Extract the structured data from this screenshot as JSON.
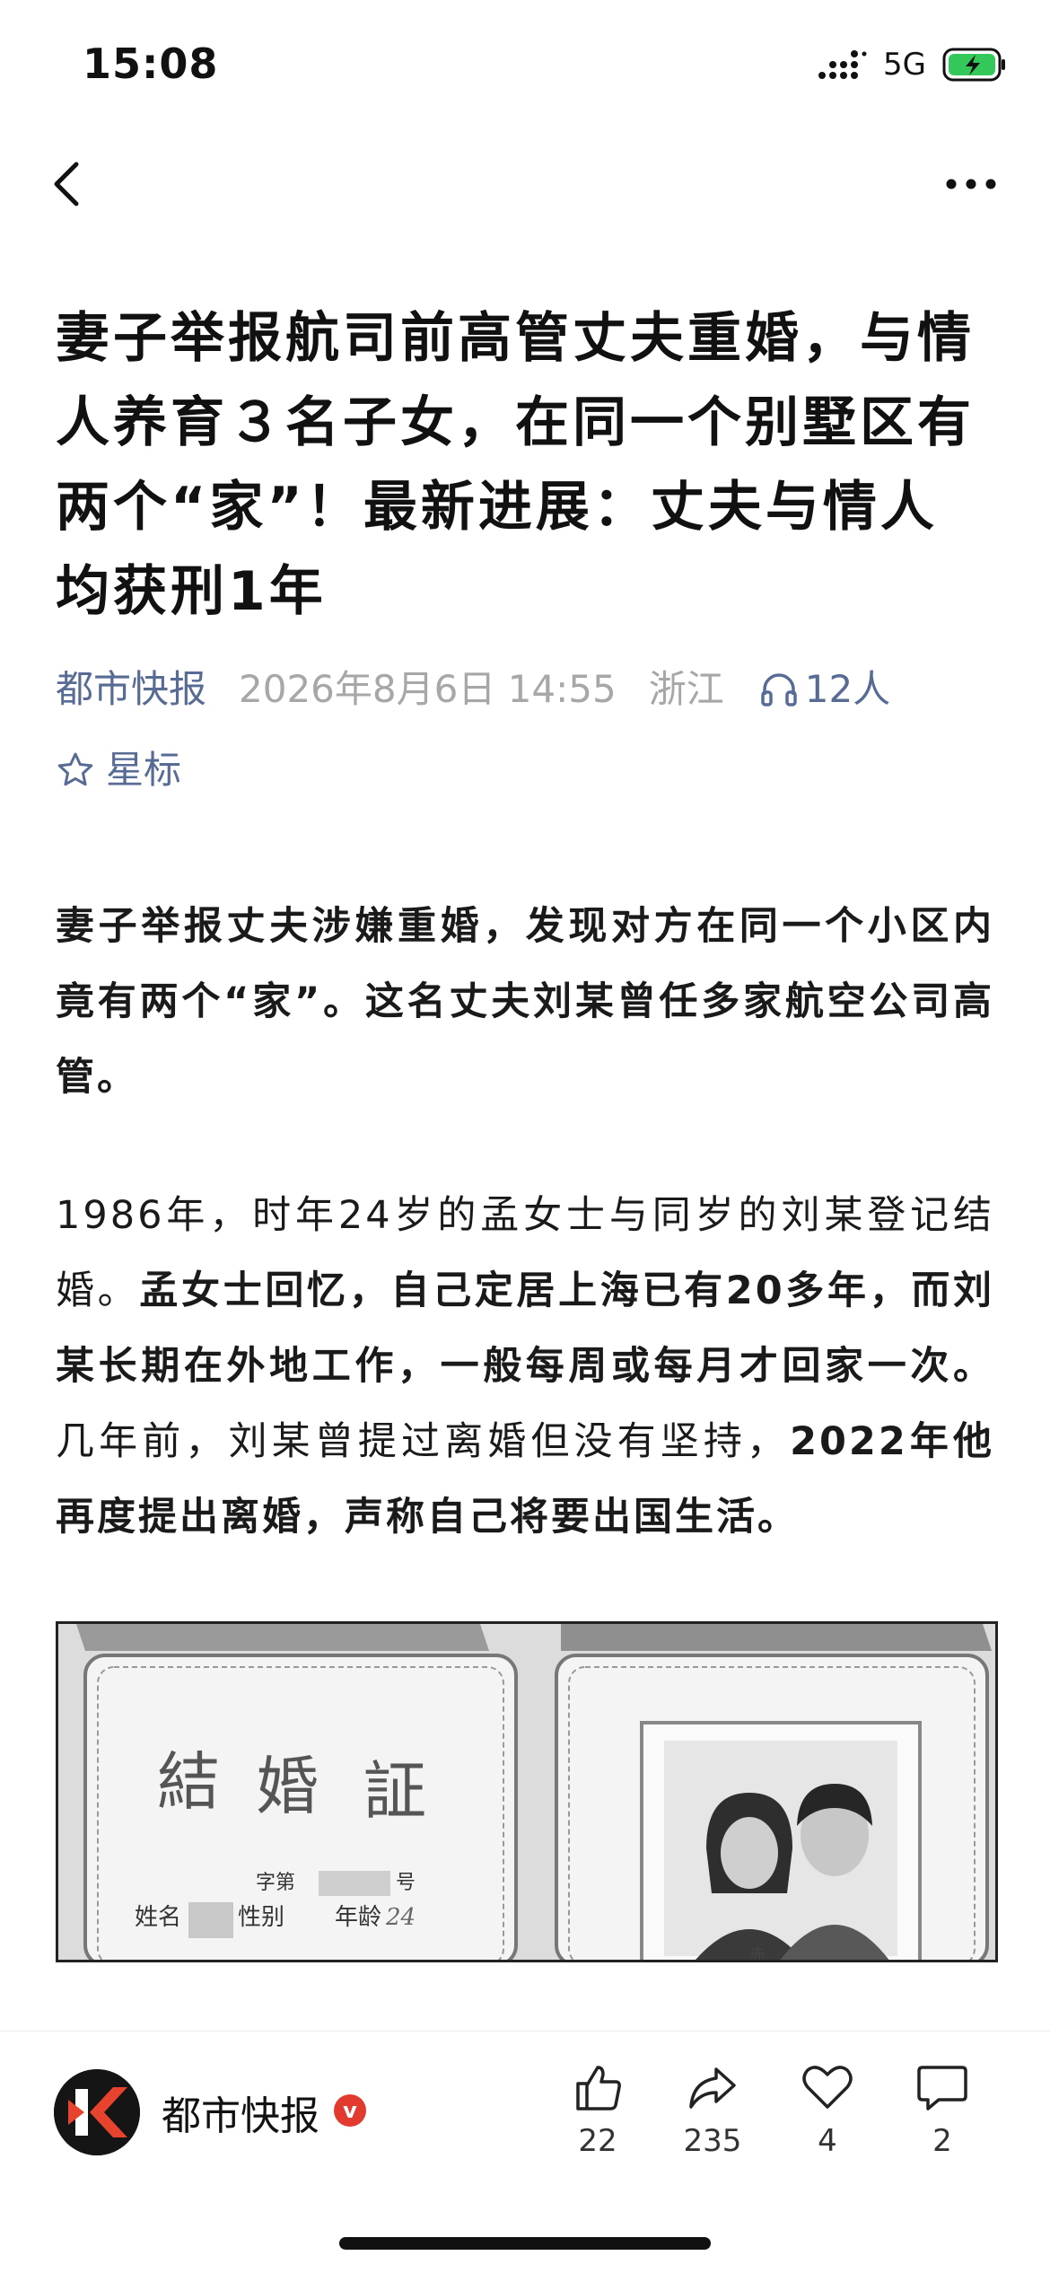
{
  "status_bar": {
    "time": "15:08",
    "network": "5G"
  },
  "article": {
    "title": "妻子举报航司前高管丈夫重婚，与情人养育３名子女，在同一个别墅区有两个“家”！最新进展：丈夫与情人均获刑1年",
    "source": "都市快报",
    "date": "2026年8月6日 14:55",
    "region": "浙江",
    "listeners": "12人",
    "star_label": "星标",
    "para1": "妻子举报丈夫涉嫌重婚，发现对方在同一个小区内竟有两个“家”。这名丈夫刘某曾任多家航空公司高管。",
    "para2_a": "1986年，时年24岁的孟女士与同岁的刘某登记结婚。",
    "para2_b": "孟女士回忆，自己定居上海已有20多年，而刘某长期在外地工作，一般每周或每月才回家一次。",
    "para2_c": "几年前，刘某曾提过离婚但没有坚持，",
    "para2_d": "2022年他再度提出离婚，声称自己将要出国生活。",
    "photo": {
      "title_chars": [
        "結",
        "婚",
        "証"
      ],
      "number_label": "字第",
      "number_suffix": "号",
      "name_label": "姓名",
      "gender_label": "性别",
      "age_label": "年龄",
      "age_value": "24"
    }
  },
  "bottom_bar": {
    "account_name": "都市快报",
    "verified_mark": "v",
    "likes": "22",
    "shares": "235",
    "favorites": "4",
    "comments": "2"
  },
  "colors": {
    "link": "#576b95",
    "meta_gray": "#a7a7a7",
    "battery_green": "#34c759",
    "verified_red": "#e23a2e"
  }
}
